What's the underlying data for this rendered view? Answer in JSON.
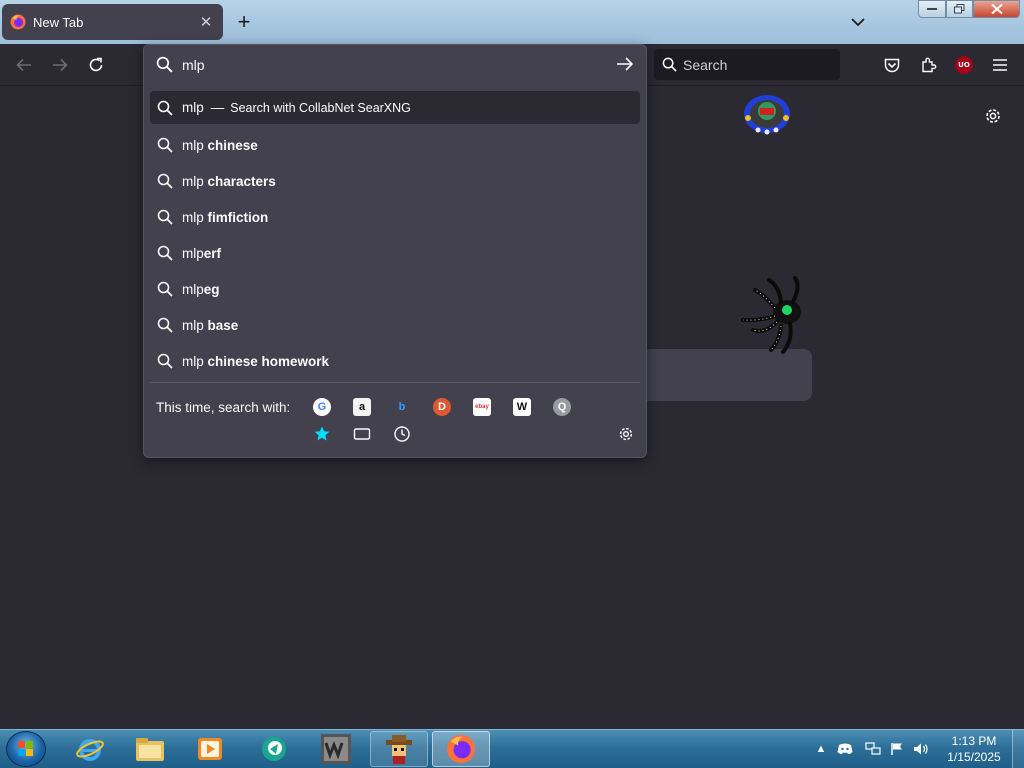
{
  "browser": {
    "tab": {
      "title": "New Tab"
    },
    "toolbar": {
      "search_placeholder": "Search"
    },
    "ublock_badge": "UO"
  },
  "urlbar": {
    "value": "mlp",
    "results": [
      {
        "prefix": "mlp",
        "bold": "",
        "dash": "—",
        "action": "Search with CollabNet SearXNG",
        "selected": true
      },
      {
        "prefix": "mlp ",
        "bold": "chinese"
      },
      {
        "prefix": "mlp ",
        "bold": "characters"
      },
      {
        "prefix": "mlp ",
        "bold": "fimfiction"
      },
      {
        "prefix": "mlp",
        "bold": "erf"
      },
      {
        "prefix": "mlp",
        "bold": "eg"
      },
      {
        "prefix": "mlp ",
        "bold": "base"
      },
      {
        "prefix": "mlp ",
        "bold": "chinese homework"
      }
    ],
    "oneoff_label": "This time, search with:",
    "engines": [
      {
        "name": "google-engine-icon",
        "glyph": "G",
        "bg": "#ffffff",
        "fg": "#4285f4"
      },
      {
        "name": "amazon-engine-icon",
        "glyph": "a",
        "bg": "#f3f3f3",
        "fg": "#111111"
      },
      {
        "name": "bing-engine-icon",
        "glyph": "b",
        "bg": "#42414d",
        "fg": "#2aa0ff"
      },
      {
        "name": "duckduckgo-engine-icon",
        "glyph": "D",
        "bg": "#de5833",
        "fg": "#ffffff"
      },
      {
        "name": "ebay-engine-icon",
        "glyph": "ebay",
        "bg": "#ffffff",
        "fg": "#e53238"
      },
      {
        "name": "wikipedia-engine-icon",
        "glyph": "W",
        "bg": "#ffffff",
        "fg": "#111111"
      },
      {
        "name": "searxng-engine-icon",
        "glyph": "Q",
        "bg": "#9a9aa3",
        "fg": "#ffffff"
      }
    ]
  },
  "taskbar": {
    "clock_time": "1:13 PM",
    "clock_date": "1/15/2025"
  },
  "colors": {
    "page_bg": "#2b2a33",
    "popup_bg": "#42414d",
    "bookmark_star": "#00ddff"
  }
}
